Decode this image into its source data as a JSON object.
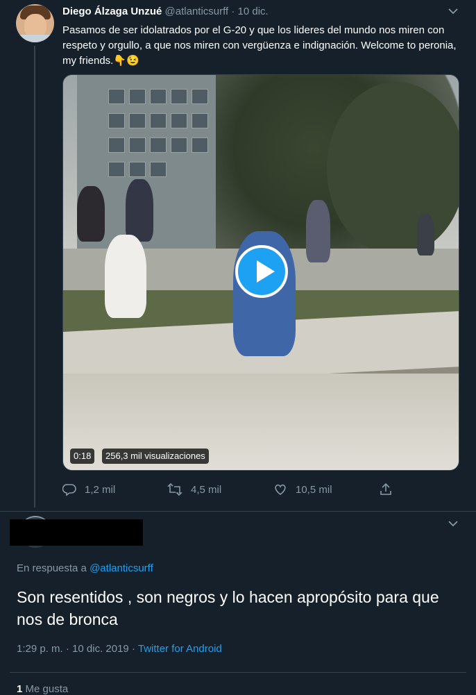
{
  "original_tweet": {
    "author_name": "Diego Álzaga Unzué",
    "handle": "@atlanticsurff",
    "separator": "·",
    "date": "10 dic.",
    "text": "Pasamos de ser idolatrados por el G-20 y que los lideres del mundo nos miren con respeto y orgullo, a que nos miren con vergüenza e indignación. Welcome to peronia, my friends.👇😉",
    "video": {
      "duration": "0:18",
      "views": "256,3 mil visualizaciones"
    },
    "actions": {
      "replies": "1,2 mil",
      "retweets": "4,5 mil",
      "likes": "10,5 mil"
    }
  },
  "reply_tweet": {
    "reply_prefix": "En respuesta a",
    "reply_handle": "@atlanticsurff",
    "text": "Son resentidos , son negros y lo hacen apropósito para que nos de bronca",
    "time": "1:29 p. m.",
    "date": "10 dic. 2019",
    "meta_separator": "·",
    "source": "Twitter for Android",
    "like_count": "1",
    "like_label": "Me gusta"
  },
  "icons": {
    "more": "chevron-down-icon",
    "reply": "reply-icon",
    "retweet": "retweet-icon",
    "like": "heart-icon",
    "share": "share-icon",
    "play": "play-icon"
  },
  "colors": {
    "background": "#15202b",
    "accent": "#1da1f2",
    "muted": "#8899a6",
    "border": "#38444d"
  }
}
